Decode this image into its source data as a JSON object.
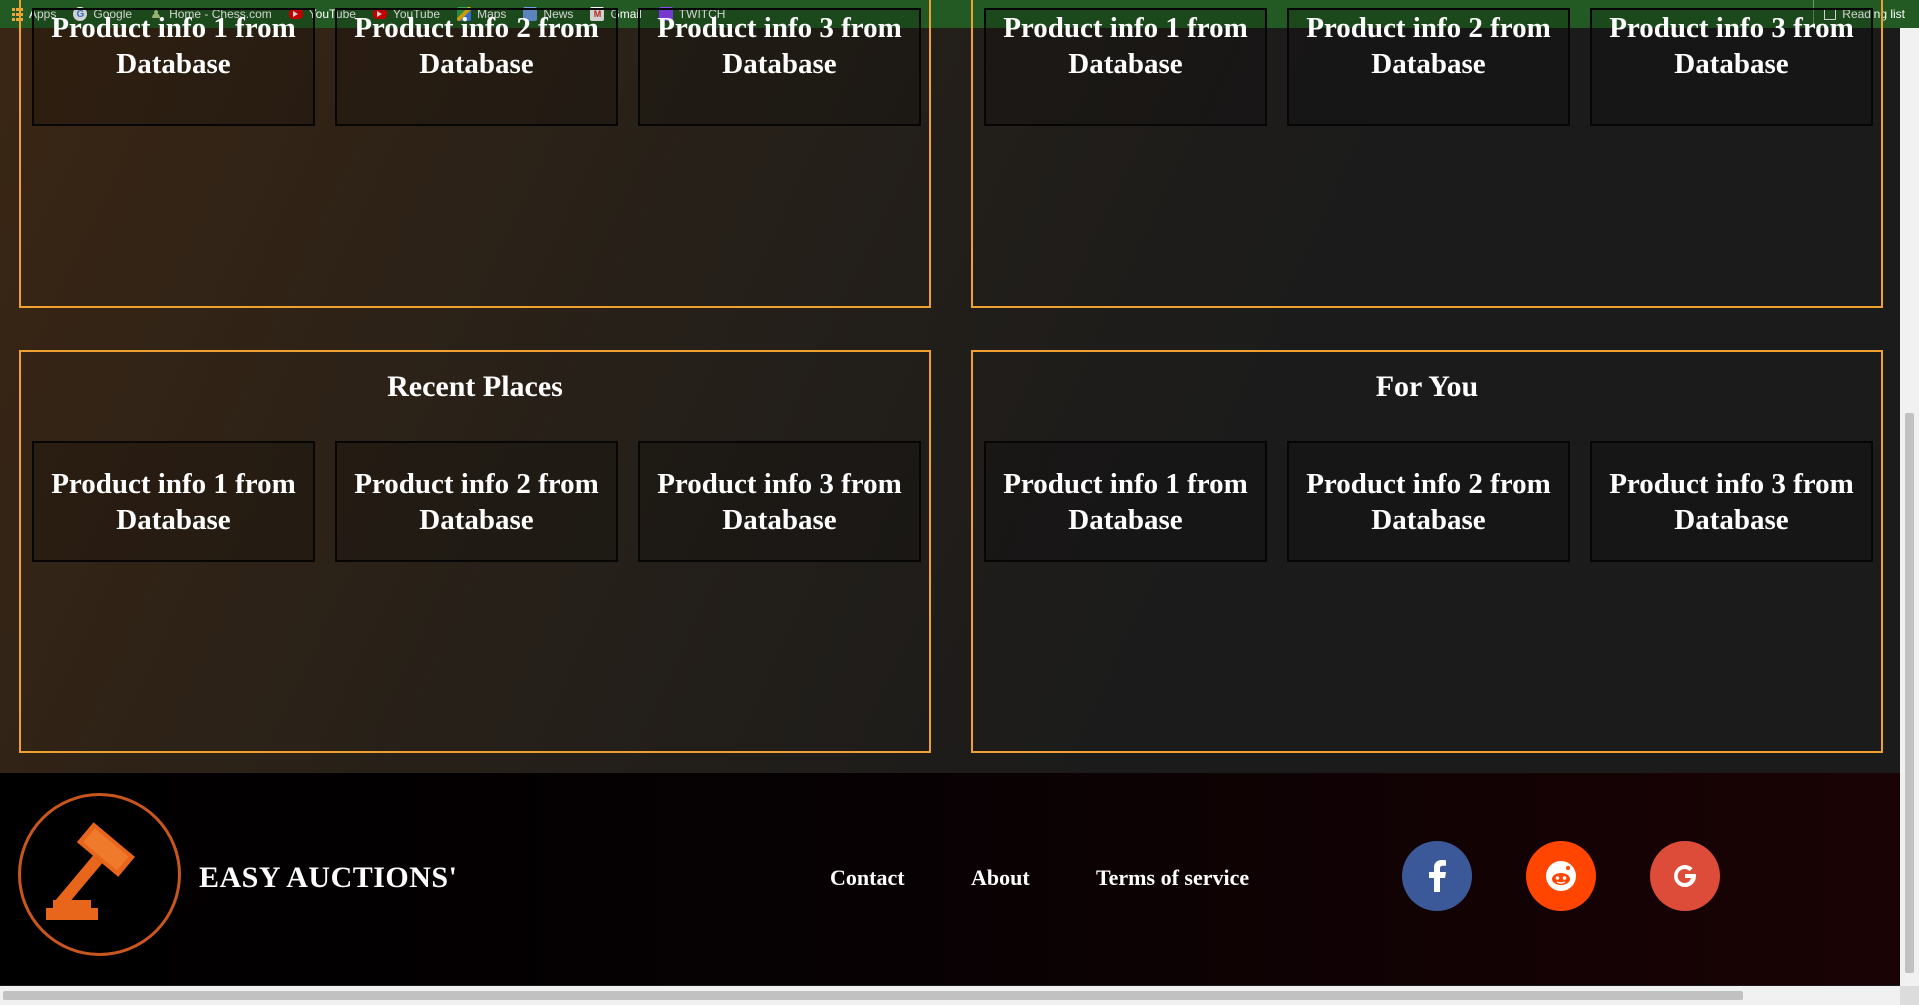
{
  "bookmarks": {
    "items": [
      {
        "label": "Apps",
        "icon": "apps-grid-icon"
      },
      {
        "label": "Google",
        "icon": "google-icon"
      },
      {
        "label": "Home - Chess.com",
        "icon": "chess-icon"
      },
      {
        "label": "YouTube",
        "icon": "youtube-icon"
      },
      {
        "label": "YouTube",
        "icon": "youtube-icon"
      },
      {
        "label": "Maps",
        "icon": "maps-icon"
      },
      {
        "label": "News",
        "icon": "news-icon"
      },
      {
        "label": "Gmail",
        "icon": "gmail-icon"
      },
      {
        "label": "TWITCH",
        "icon": "twitch-icon"
      }
    ],
    "reading_list": "Reading list"
  },
  "panels": [
    {
      "title": "",
      "cards": [
        "Product info 1 from Database",
        "Product info 2 from Database",
        "Product info 3 from Database"
      ]
    },
    {
      "title": "",
      "cards": [
        "Product info 1 from Database",
        "Product info 2 from Database",
        "Product info 3 from Database"
      ]
    },
    {
      "title": "Recent Places",
      "cards": [
        "Product info 1 from Database",
        "Product info 2 from Database",
        "Product info 3 from Database"
      ]
    },
    {
      "title": "For You",
      "cards": [
        "Product info 1 from Database",
        "Product info 2 from Database",
        "Product info 3 from Database"
      ]
    }
  ],
  "footer": {
    "brand": "EASY AUCTIONS'",
    "links": [
      "Contact",
      "About",
      "Terms of service"
    ],
    "social": [
      {
        "name": "facebook",
        "icon": "facebook-icon",
        "color": "#3b5998"
      },
      {
        "name": "reddit",
        "icon": "reddit-icon",
        "color": "#ff4500"
      },
      {
        "name": "google",
        "icon": "google-plus-icon",
        "color": "#dd4b39"
      }
    ]
  },
  "colors": {
    "panel_border": "#f0a030",
    "bookmarks_bar": "#235a23",
    "logo_accent": "#e8661c"
  }
}
